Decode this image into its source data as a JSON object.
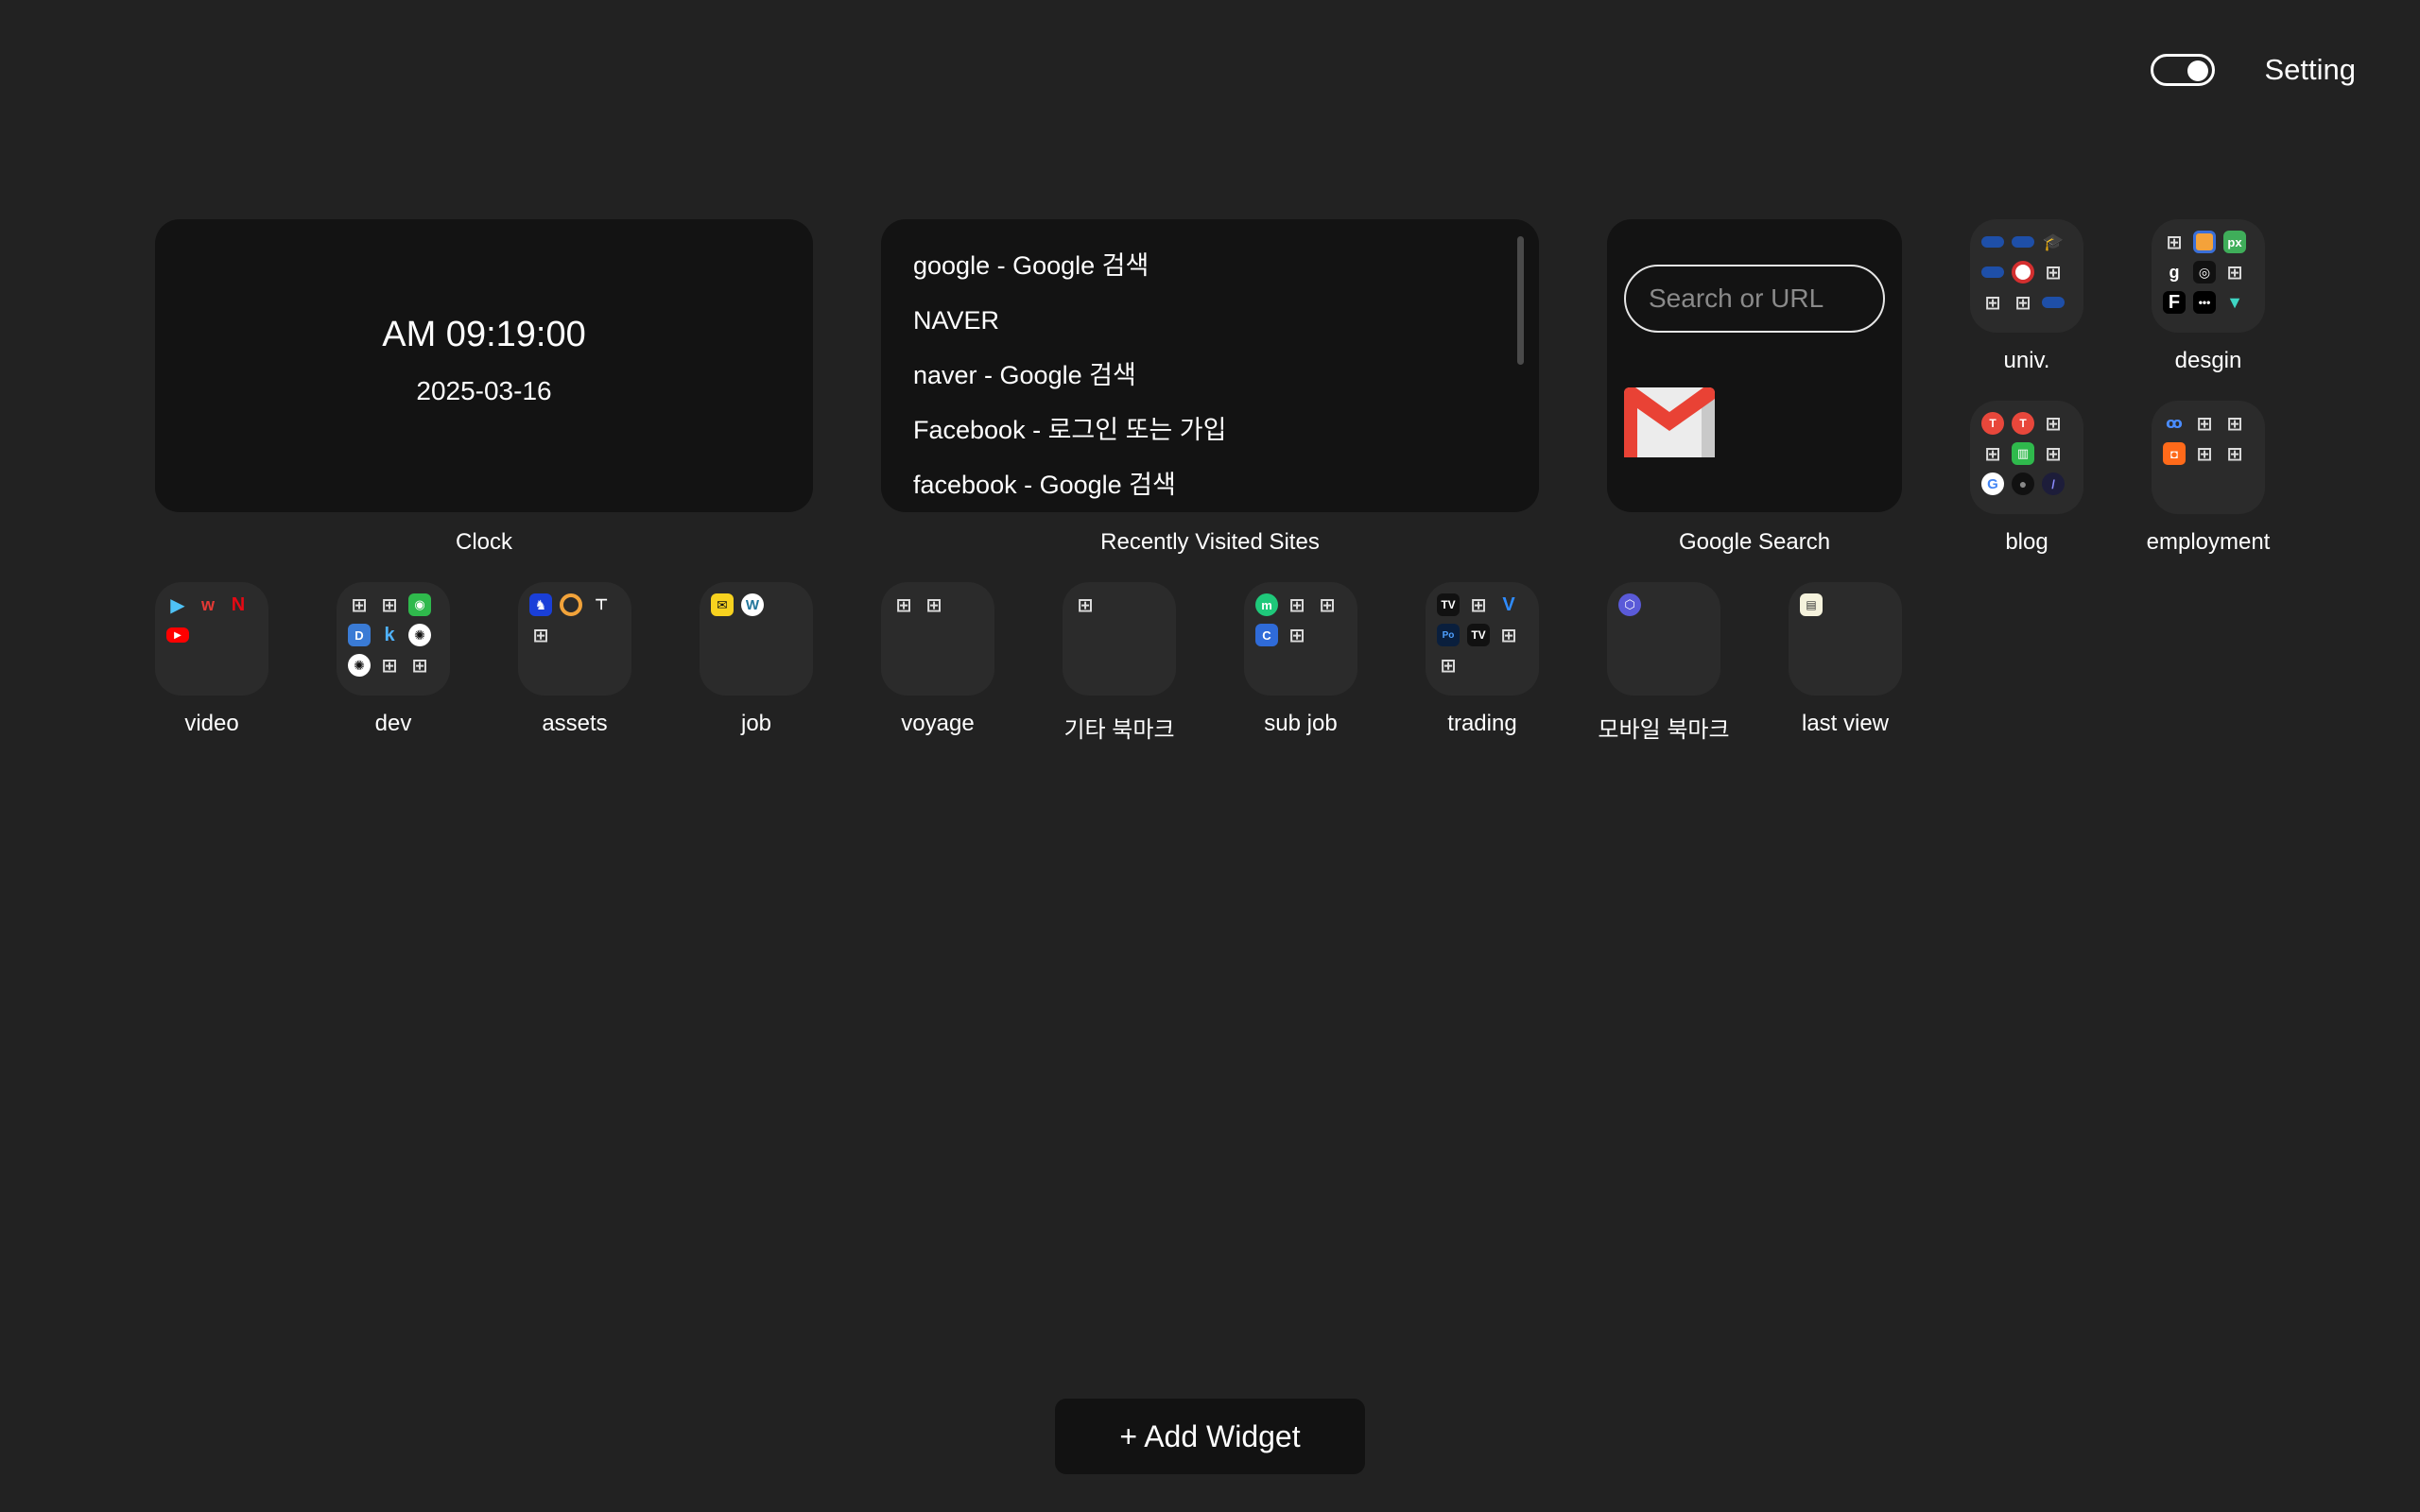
{
  "topbar": {
    "setting_label": "Setting"
  },
  "clock": {
    "time": "AM 09:19:00",
    "date": "2025-03-16",
    "label": "Clock"
  },
  "recent": {
    "label": "Recently Visited Sites",
    "items": [
      "google - Google 검색",
      "NAVER",
      "naver - Google 검색",
      "Facebook - 로그인 또는 가입",
      "facebook - Google 검색"
    ]
  },
  "search": {
    "placeholder": "Search or URL",
    "label": "Google Search"
  },
  "folders": {
    "univ": "univ.",
    "desgin": "desgin",
    "blog": "blog",
    "employment": "employment",
    "video": "video",
    "dev": "dev",
    "assets": "assets",
    "job": "job",
    "voyage": "voyage",
    "etc": "기타 북마크",
    "subjob": "sub job",
    "trading": "trading",
    "mobile": "모바일 북마크",
    "lastview": "last view"
  },
  "icon_names": {
    "generic": "app-grid-icon",
    "gmail": "gmail-icon",
    "theme": "theme-toggle"
  },
  "colors": {
    "background": "#222222",
    "card": "#131313",
    "folder": "#2b2b2b"
  },
  "add_widget_label": "+ Add Widget"
}
